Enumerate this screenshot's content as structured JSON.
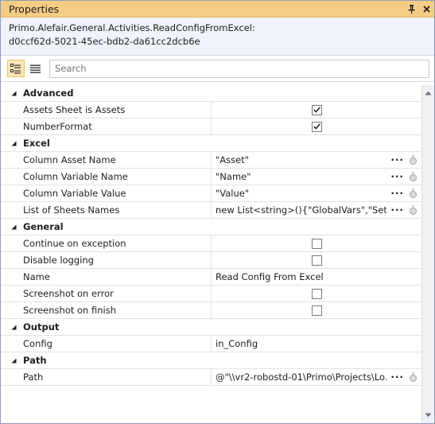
{
  "window": {
    "title": "Properties",
    "activity_path": "Primo.Alefair.General.Activities.ReadConfigFromExcel:",
    "activity_id": "d0ccf62d-5021-45ec-bdb2-da61cc2dcb6e"
  },
  "search": {
    "placeholder": "Search",
    "value": ""
  },
  "categories": {
    "advanced": {
      "label": "Advanced",
      "assets_sheet": {
        "label": "Assets Sheet is Assets",
        "checked": true
      },
      "number_format": {
        "label": "NumberFormat",
        "checked": true
      }
    },
    "excel": {
      "label": "Excel",
      "column_asset_name": {
        "label": "Column Asset Name",
        "value": "\"Asset\""
      },
      "column_variable_name": {
        "label": "Column Variable Name",
        "value": "\"Name\""
      },
      "column_variable_value": {
        "label": "Column Variable Value",
        "value": "\"Value\""
      },
      "list_of_sheets": {
        "label": "List of Sheets Names",
        "value": "new List<string>(){\"GlobalVars\",\"Settin..."
      }
    },
    "general": {
      "label": "General",
      "continue_on_exception": {
        "label": "Continue on exception",
        "checked": false
      },
      "disable_logging": {
        "label": "Disable logging",
        "checked": false
      },
      "name": {
        "label": "Name",
        "value": "Read Config From Excel"
      },
      "screenshot_on_error": {
        "label": "Screenshot on error",
        "checked": false
      },
      "screenshot_on_finish": {
        "label": "Screenshot on finish",
        "checked": false
      }
    },
    "output": {
      "label": "Output",
      "config": {
        "label": "Config",
        "value": "in_Config"
      }
    },
    "path": {
      "label": "Path",
      "path": {
        "label": "Path",
        "value": "@\"\\\\vr2-robostd-01\\Primo\\Projects\\Lo..."
      }
    }
  },
  "icons": {
    "pin": "pin-icon",
    "close": "close-icon",
    "categorized_view": "categorized-view-icon",
    "alphabetical_view": "list-view-icon",
    "ellipsis": "ellipsis-icon",
    "dropdown": "dropdown-icon"
  },
  "colors": {
    "title_bar": "#f5cc84",
    "description_bg": "#f0f3fb",
    "active_toolbar_button": "#fbe6b6"
  }
}
